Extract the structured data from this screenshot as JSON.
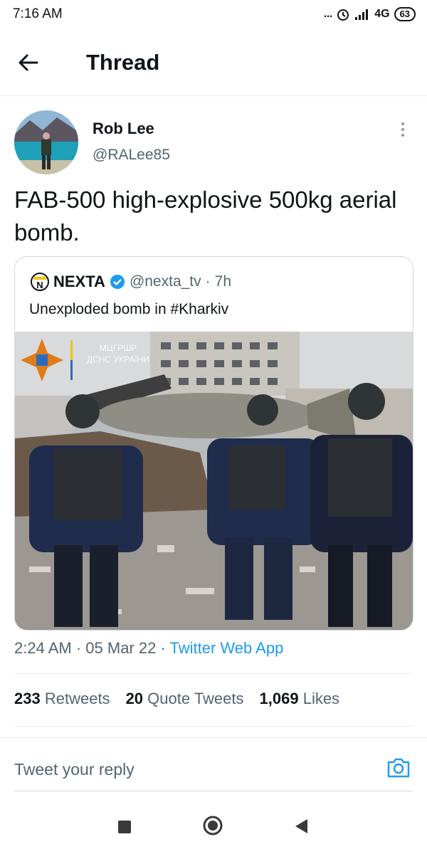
{
  "status": {
    "time": "7:16 AM",
    "dots": "...",
    "network": "4G",
    "battery": "63"
  },
  "header": {
    "title": "Thread"
  },
  "tweet": {
    "author_name": "Rob Lee",
    "author_handle": "@RALee85",
    "text": "FAB-500 high-explosive 500kg aerial bomb.",
    "time": "2:24 AM",
    "date": "05 Mar 22",
    "source": "Twitter Web App",
    "sep": "·"
  },
  "quote": {
    "name": "NEXTA",
    "handle": "@nexta_tv",
    "age": "7h",
    "text": "Unexploded bomb in #Kharkiv",
    "watermark_line1": "МЦГРШР",
    "watermark_line2": "ДСНС УКРАЇНИ",
    "logo_letter": "N"
  },
  "stats": {
    "retweets_count": "233",
    "retweets_label": "Retweets",
    "quotes_count": "20",
    "quotes_label": "Quote Tweets",
    "likes_count": "1,069",
    "likes_label": "Likes"
  },
  "reply": {
    "placeholder": "Tweet your reply"
  },
  "colors": {
    "accent": "#1d9bf0",
    "text": "#0f1419",
    "muted": "#536471",
    "divider": "#e6ecf0"
  },
  "icons": {
    "back": "arrow-left-icon",
    "more": "more-vertical-icon",
    "camera": "camera-icon",
    "verified": "verified-badge-icon"
  }
}
